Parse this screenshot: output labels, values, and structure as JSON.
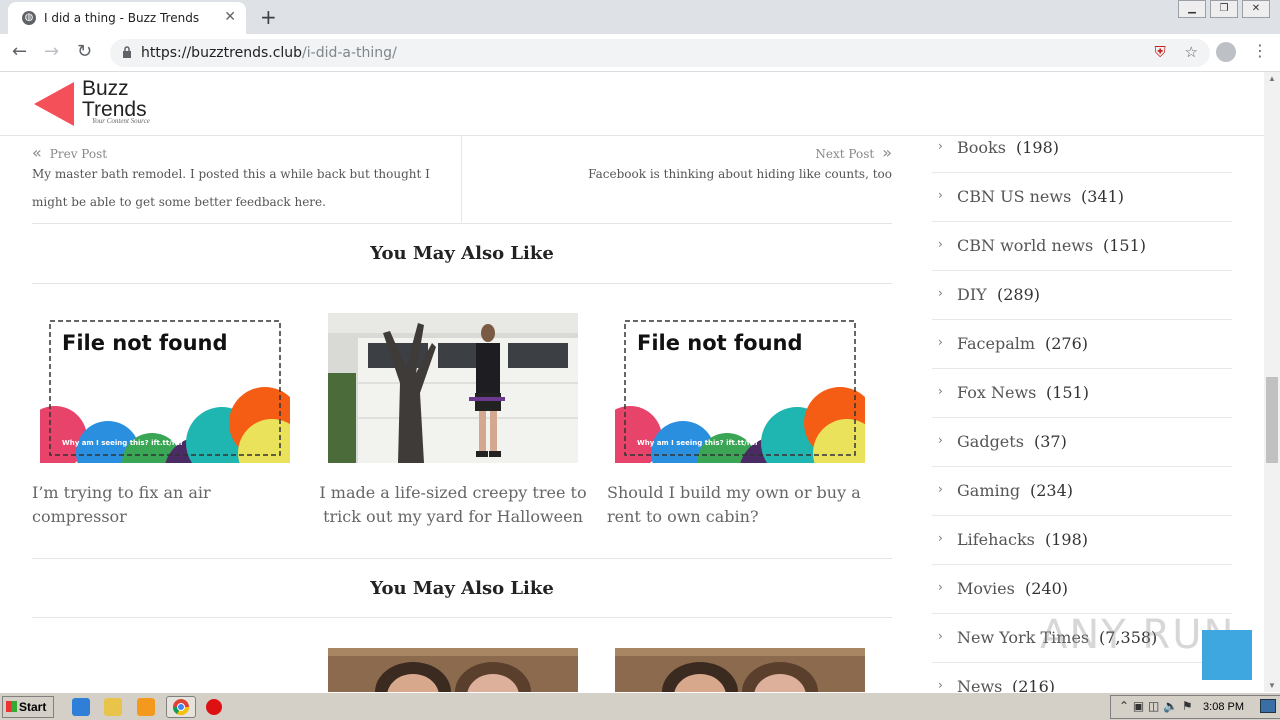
{
  "browser": {
    "tab_title": "I did a thing - Buzz Trends",
    "url_host": "https://buzztrends.club",
    "url_path": "/i-did-a-thing/"
  },
  "site": {
    "logo_line1": "Buzz",
    "logo_line2": "Trends",
    "tagline": "Your Content Source",
    "brand_color": "#f4505a"
  },
  "post_nav": {
    "prev_label": "Prev Post",
    "prev_title": "My master bath remodel. I posted this a while back but thought I might be able to get some better feedback here.",
    "next_label": "Next Post",
    "next_title": "Facebook is thinking about hiding like counts, too"
  },
  "related": [
    {
      "heading": "You May Also Like",
      "cards": [
        {
          "title": "I’m trying to fix an air compressor",
          "image": "file-not-found",
          "image_text": "File not found",
          "image_subtext": "Why am I seeing this? ift.tt/fnf"
        },
        {
          "title": "I made a life-sized creepy tree to trick out my yard for Halloween",
          "image": "photo-tree"
        },
        {
          "title": "Should I build my own or buy a rent to own cabin?",
          "image": "file-not-found",
          "image_text": "File not found",
          "image_subtext": "Why am I seeing this? ift.tt/fnf"
        }
      ]
    },
    {
      "heading": "You May Also Like"
    }
  ],
  "sidebar": {
    "categories": [
      {
        "name": "Books",
        "count": "(198)"
      },
      {
        "name": "CBN US news",
        "count": "(341)"
      },
      {
        "name": "CBN world news",
        "count": "(151)"
      },
      {
        "name": "DIY",
        "count": "(289)"
      },
      {
        "name": "Facepalm",
        "count": "(276)"
      },
      {
        "name": "Fox News",
        "count": "(151)"
      },
      {
        "name": "Gadgets",
        "count": "(37)"
      },
      {
        "name": "Gaming",
        "count": "(234)"
      },
      {
        "name": "Lifehacks",
        "count": "(198)"
      },
      {
        "name": "Movies",
        "count": "(240)"
      },
      {
        "name": "New York Times",
        "count": "(7,358)"
      },
      {
        "name": "News",
        "count": "(216)"
      }
    ]
  },
  "watermark": "ANY RUN",
  "taskbar": {
    "start_label": "Start",
    "clock": "3:08 PM"
  }
}
